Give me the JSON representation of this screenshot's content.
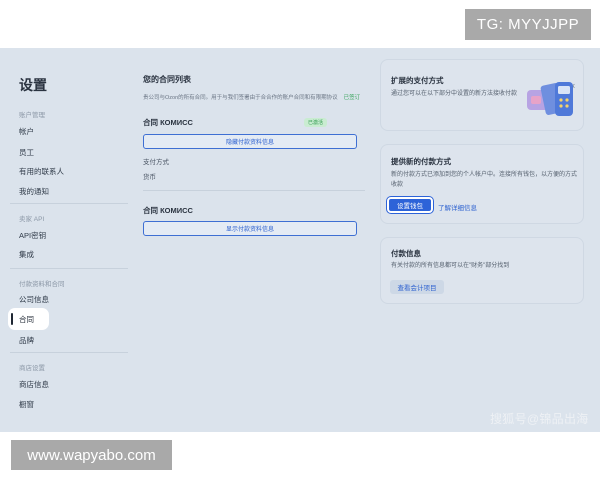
{
  "watermarks": {
    "top": "TG: MYYJJPP",
    "bottom": "www.wapyabo.com",
    "sohu": "搜狐号@锦品出海"
  },
  "sidebar": {
    "title": "设置",
    "sections": [
      {
        "label": "账户管理",
        "items": [
          "帐户",
          "员工",
          "有用的联系人",
          "我的通知"
        ]
      },
      {
        "label": "卖家 API",
        "items": [
          "API密钥",
          "集成"
        ]
      },
      {
        "label": "付款资料和合同",
        "items": [
          "公司信息",
          "合同",
          "品牌"
        ]
      },
      {
        "label": "商店设置",
        "items": [
          "商店信息",
          "橱窗"
        ]
      }
    ],
    "active_item": "合同"
  },
  "main": {
    "title": "您的合同列表",
    "description": "贵公司与Ozon的所有合同。用于与我们签署由于合合作的账户合同和有限期协议",
    "description_link": "已签订",
    "contract1": {
      "title": "合同 КОМИСС",
      "badge": "已激活",
      "button": "隐藏付款资料信息",
      "field_label": "支付方式",
      "field_value": "货币"
    },
    "contract2": {
      "title": "合同 КОМИСС",
      "button": "显示付款资料信息"
    }
  },
  "cards": {
    "extended": {
      "title": "扩展的支付方式",
      "text": "通过您可以在以下部分中设置的新方法接收付款",
      "close": "×",
      "illustration": "wallet-card-terminal-illustration"
    },
    "new_payment": {
      "title": "提供新的付款方式",
      "text": "新的付款方式已添加到您的个人帐户中。连接所有钱包，以方便的方式收款",
      "primary_button": "设置钱包",
      "link": "了解详细信息"
    },
    "payment_info": {
      "title": "付款信息",
      "text": "有关付款的所有信息都可以在\"财务\"部分找到",
      "button": "查看会计项目"
    }
  },
  "colors": {
    "overlay_bg": "#dbe3ec",
    "accent_blue": "#2d63d8",
    "success_green": "#37a35b",
    "watermark_gray": "#a9a9a9"
  }
}
